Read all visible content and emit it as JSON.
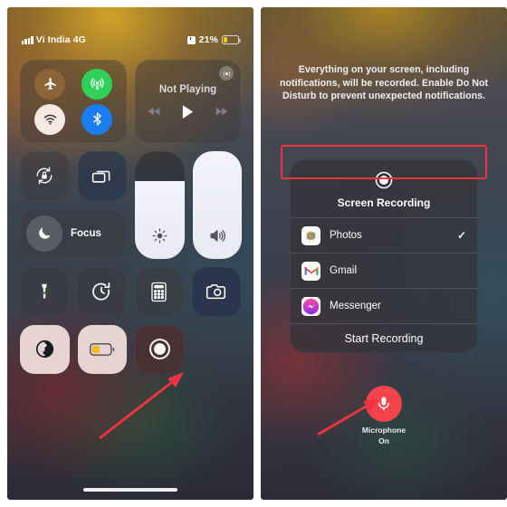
{
  "left_panel": {
    "status_bar": {
      "signal_icon": "cellular-bars-icon",
      "carrier": "Vi India 4G",
      "alarm_icon": "alarm-icon",
      "battery_percent": "21%",
      "battery_icon": "battery-low-icon"
    },
    "connectivity": {
      "airplane": {
        "label": "airplane-mode",
        "state": "off",
        "color": "#8c6438"
      },
      "cellular": {
        "label": "cellular-data",
        "state": "on",
        "color": "#30d158"
      },
      "wifi": {
        "label": "wifi",
        "state": "on",
        "color": "#f6e9e4"
      },
      "bluetooth": {
        "label": "bluetooth",
        "state": "on",
        "color": "#1a7ef2"
      }
    },
    "media": {
      "title": "Not Playing",
      "airplay_icon": "airplay-icon",
      "previous_icon": "rewind-icon",
      "play_icon": "play-icon",
      "next_icon": "fast-forward-icon"
    },
    "tiles": {
      "rotation_lock": "rotation-lock-icon",
      "screen_mirroring": "screen-mirroring-icon",
      "focus_label": "Focus",
      "focus_icon": "moon-icon",
      "brightness_icon": "brightness-icon",
      "volume_icon": "volume-icon",
      "flashlight": "flashlight-icon",
      "timer": "timer-icon",
      "calculator": "calculator-icon",
      "camera": "camera-icon",
      "dark_mode": "dark-mode-icon",
      "low_power": "low-power-mode-icon",
      "screen_record": "screen-record-icon"
    },
    "annotation": {
      "arrow_color": "#ef3340",
      "points_to": "screen-record-tile"
    }
  },
  "right_panel": {
    "notice": "Everything on your screen, including notifications, will be recorded. Enable Do Not Disturb to prevent unexpected notifications.",
    "sheet": {
      "icon": "screen-record-icon",
      "title": "Screen Recording",
      "destinations": [
        {
          "name": "Photos",
          "icon": "photos-icon",
          "selected": true,
          "check": "✓"
        },
        {
          "name": "Gmail",
          "icon": "gmail-icon",
          "selected": false,
          "check": ""
        },
        {
          "name": "Messenger",
          "icon": "messenger-icon",
          "selected": false,
          "check": ""
        }
      ],
      "start_button": "Start Recording"
    },
    "microphone": {
      "icon": "microphone-icon",
      "label": "Microphone",
      "state": "On",
      "color": "#f4434a"
    },
    "annotations": {
      "highlight_color": "#ef3340",
      "highlight_target": "start-recording-button",
      "arrow_color": "#ef3340",
      "arrow_points_to": "microphone-button"
    }
  }
}
